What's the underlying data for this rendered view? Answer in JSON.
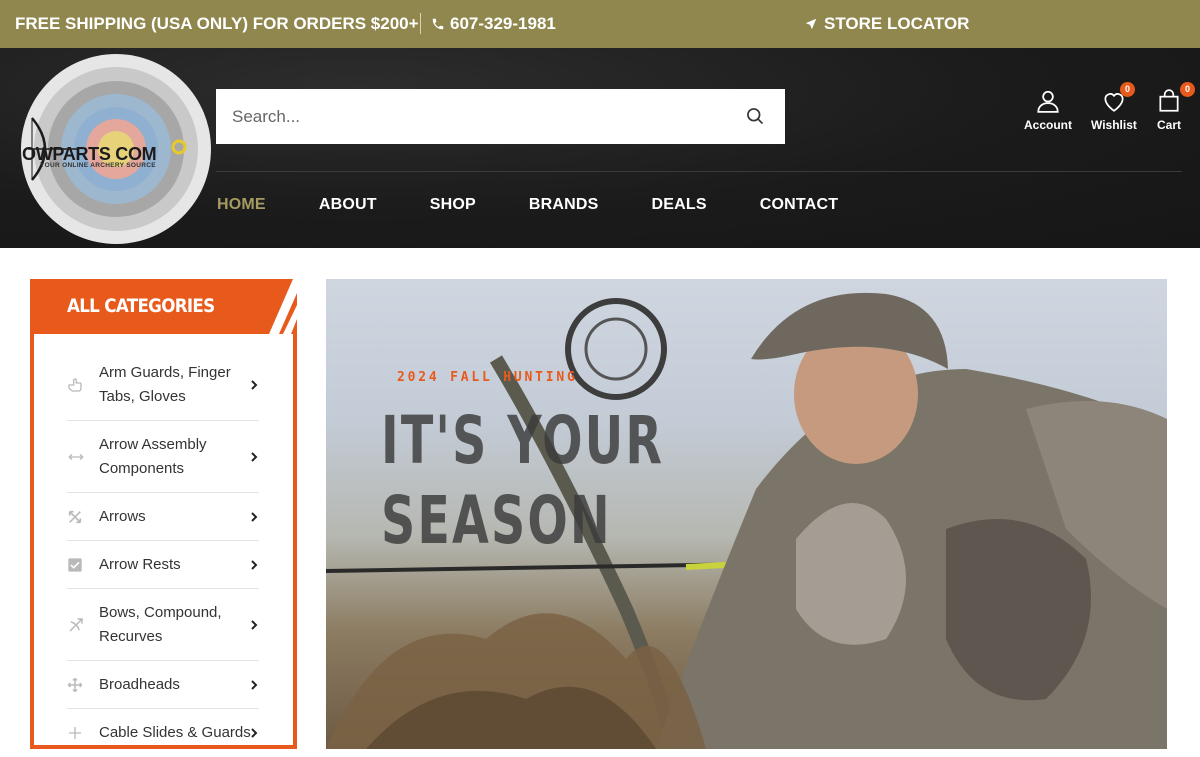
{
  "topbar": {
    "shipping": "FREE SHIPPING (USA ONLY) FOR ORDERS $200+",
    "phone": "607-329-1981",
    "store_locator": "STORE LOCATOR"
  },
  "logo": {
    "text": "OWPARTS COM",
    "tagline": "YOUR ONLINE ARCHERY SOURCE"
  },
  "search": {
    "placeholder": "Search..."
  },
  "header_icons": {
    "account": "Account",
    "wishlist": "Wishlist",
    "wishlist_count": "0",
    "cart": "Cart",
    "cart_count": "0"
  },
  "nav": [
    "HOME",
    "ABOUT",
    "SHOP",
    "BRANDS",
    "DEALS",
    "CONTACT"
  ],
  "sidebar": {
    "title": "ALL CATEGORIES",
    "items": [
      {
        "label": "Arm Guards, Finger Tabs, Gloves",
        "icon": "hand-pointer-icon"
      },
      {
        "label": "Arrow Assembly Components",
        "icon": "arrows-horizontal-icon"
      },
      {
        "label": "Arrows",
        "icon": "crossed-arrows-icon"
      },
      {
        "label": "Arrow Rests",
        "icon": "check-square-icon"
      },
      {
        "label": "Bows, Compound, Recurves",
        "icon": "bow-icon"
      },
      {
        "label": "Broadheads",
        "icon": "move-cross-icon"
      },
      {
        "label": "Cable Slides & Guards",
        "icon": "plus-icon"
      }
    ]
  },
  "hero": {
    "subtitle": "2024 FALL HUNTING",
    "title_line1": "IT'S YOUR",
    "title_line2": "SEASON"
  },
  "colors": {
    "topbar": "#8f874e",
    "header": "#1b1b1b",
    "accent_orange": "#e85a1c",
    "nav_active": "#a59b62"
  }
}
